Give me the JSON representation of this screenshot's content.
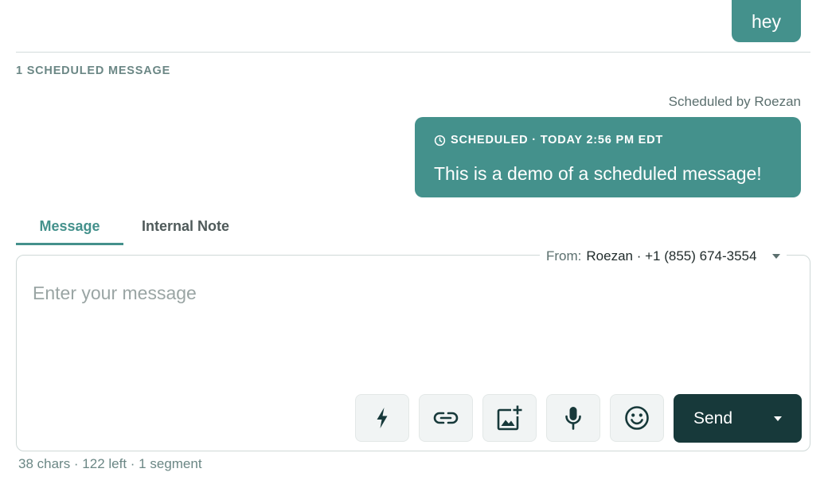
{
  "thread": {
    "last_sent_message": "hey"
  },
  "scheduled": {
    "section_header": "1 SCHEDULED MESSAGE",
    "scheduled_by": "Scheduled by Roezan",
    "status_line": "SCHEDULED · TODAY 2:56 PM EDT",
    "message_text": "This is a demo of a scheduled message!",
    "status_icon": "clock-icon"
  },
  "tabs": [
    {
      "label": "Message",
      "active": true
    },
    {
      "label": "Internal Note",
      "active": false
    }
  ],
  "composer": {
    "from_label": "From:",
    "from_value": "Roezan · +1 (855) 674-3554",
    "placeholder": "Enter your message",
    "value": "",
    "toolbar": [
      {
        "icon": "lightning-icon",
        "action": "snippets"
      },
      {
        "icon": "link-icon",
        "action": "insert-link"
      },
      {
        "icon": "add-image-icon",
        "action": "attach-image"
      },
      {
        "icon": "microphone-icon",
        "action": "record-voice"
      },
      {
        "icon": "emoji-icon",
        "action": "insert-emoji"
      }
    ],
    "send_label": "Send"
  },
  "counter": "38 chars · 122 left · 1 segment",
  "colors": {
    "accent": "#44918c",
    "send_button": "#17393a",
    "muted_text": "#6b8785"
  }
}
